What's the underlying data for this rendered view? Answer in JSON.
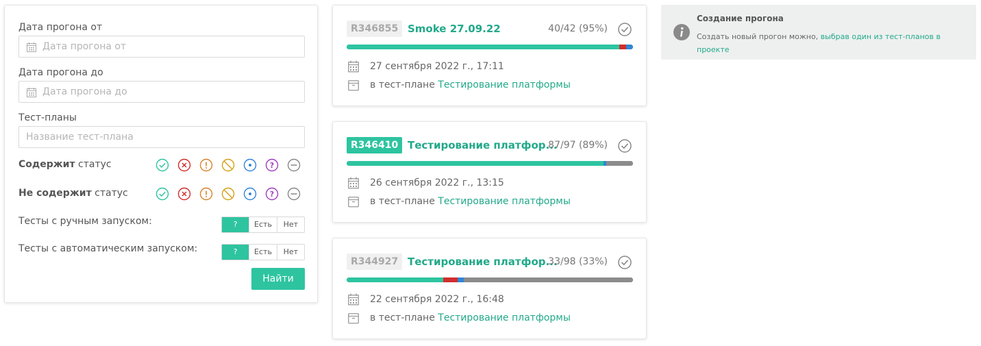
{
  "filters": {
    "date_from_label": "Дата прогона от",
    "date_from_placeholder": "Дата прогона от",
    "date_to_label": "Дата прогона до",
    "date_to_placeholder": "Дата прогона до",
    "plans_label": "Тест-планы",
    "plans_placeholder": "Название тест-плана",
    "contains_bold": "Содержит",
    "contains_rest": " статус",
    "not_contains_bold": "Не содержит",
    "not_contains_rest": " статус",
    "manual_label": "Тесты с ручным запуском:",
    "auto_label": "Тесты с автоматическим запуском:",
    "toggle_any": "?",
    "toggle_yes": "Есть",
    "toggle_no": "Нет",
    "find_button": "Найти",
    "status_icons": [
      "passed-icon",
      "failed-icon",
      "warning-icon",
      "blocked-icon",
      "in-progress-icon",
      "unknown-icon",
      "skipped-icon"
    ]
  },
  "runs": [
    {
      "id": "R346855",
      "name": "Smoke 27.09.22",
      "stats": "40/42 (95%)",
      "date": "27 сентября 2022 г., 17:11",
      "plan_prefix": "в тест-плане ",
      "plan_link": "Тестирование платформы",
      "highlighted": false,
      "progress": [
        {
          "status": "passed",
          "fraction": 0.952,
          "color": "#2ec4a0"
        },
        {
          "status": "failed",
          "fraction": 0.024,
          "color": "#d12d2d"
        },
        {
          "status": "in-progress",
          "fraction": 0.024,
          "color": "#2f86d8"
        }
      ]
    },
    {
      "id": "R346410",
      "name": "Тестирование платфор...",
      "stats": "87/97 (89%)",
      "date": "26 сентября 2022 г., 13:15",
      "plan_prefix": "в тест-плане ",
      "plan_link": "Тестирование платформы",
      "highlighted": true,
      "progress": [
        {
          "status": "passed",
          "fraction": 0.897,
          "color": "#2ec4a0"
        },
        {
          "status": "in-progress",
          "fraction": 0.01,
          "color": "#2f86d8"
        },
        {
          "status": "untested",
          "fraction": 0.093,
          "color": "#8c8c8c"
        }
      ]
    },
    {
      "id": "R344927",
      "name": "Тестирование платфор...",
      "stats": "33/98 (33%)",
      "date": "22 сентября 2022 г., 16:48",
      "plan_prefix": "в тест-плане ",
      "plan_link": "Тестирование платформы",
      "highlighted": false,
      "progress": [
        {
          "status": "passed",
          "fraction": 0.337,
          "color": "#2ec4a0"
        },
        {
          "status": "failed",
          "fraction": 0.051,
          "color": "#d12d2d"
        },
        {
          "status": "in-progress",
          "fraction": 0.02,
          "color": "#2f86d8"
        },
        {
          "status": "untested",
          "fraction": 0.592,
          "color": "#8c8c8c"
        }
      ]
    }
  ],
  "info": {
    "title": "Создание прогона",
    "text_before": "Создать новый прогон можно, ",
    "link": "выбрав один из тест-планов в проекте"
  },
  "colors": {
    "accent": "#2ec4a0",
    "link": "#22a98a",
    "failed": "#d12d2d",
    "in_progress": "#2f86d8",
    "untested": "#8c8c8c"
  }
}
